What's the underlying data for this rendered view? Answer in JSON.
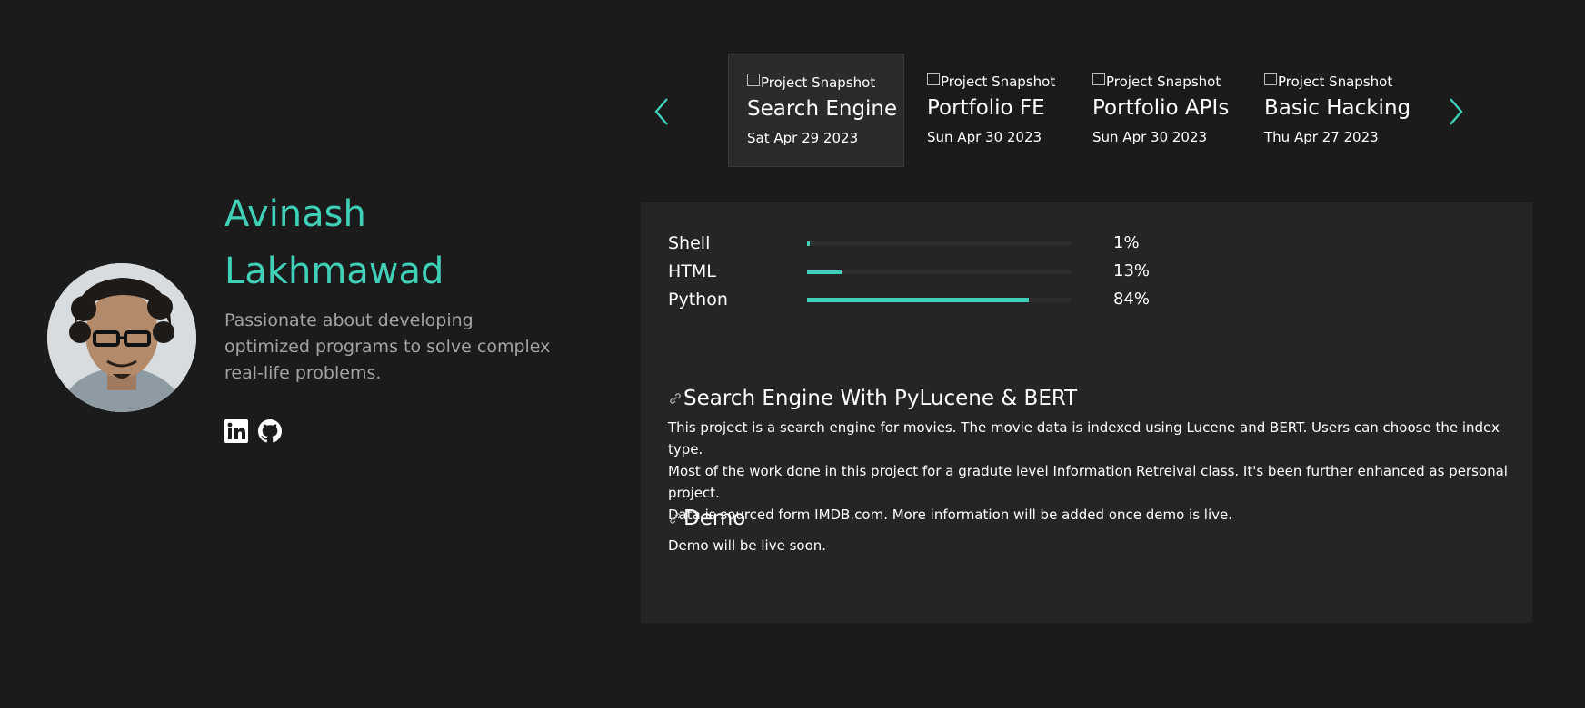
{
  "profile": {
    "first_name": "Avinash",
    "last_name": "Lakhmawad",
    "bio": "Passionate about developing optimized programs to solve complex real-life problems.",
    "socials": [
      "linkedin-icon",
      "github-icon"
    ]
  },
  "carousel": {
    "prev_icon": "chevron-left-icon",
    "next_icon": "chevron-right-icon",
    "cards": [
      {
        "snapshot_alt": "Project Snapshot",
        "title": "Search Engine",
        "date": "Sat Apr 29 2023",
        "active": true
      },
      {
        "snapshot_alt": "Project Snapshot",
        "title": "Portfolio FE",
        "date": "Sun Apr 30 2023",
        "active": false
      },
      {
        "snapshot_alt": "Project Snapshot",
        "title": "Portfolio APIs",
        "date": "Sun Apr 30 2023",
        "active": false
      },
      {
        "snapshot_alt": "Project Snapshot",
        "title": "Basic Hacking",
        "date": "Thu Apr 27 2023",
        "active": false
      }
    ]
  },
  "languages": [
    {
      "name": "Shell",
      "percent_label": "1%",
      "fraction": 0.01
    },
    {
      "name": "HTML",
      "percent_label": "13%",
      "fraction": 0.13
    },
    {
      "name": "Python",
      "percent_label": "84%",
      "fraction": 0.84
    }
  ],
  "detail": {
    "heading": "Search Engine With PyLucene & BERT",
    "para1": "This project is a search engine for movies. The movie data is indexed using Lucene and BERT. Users can choose the index type.",
    "para2": "Most of the work done in this project for a gradute level Information Retreival class. It's been further enhanced as personal project.",
    "para3": "Data is sourced form IMDB.com. More information will be added once demo is live.",
    "demo_heading": "Demo",
    "demo_text": "Demo will be live soon."
  },
  "colors": {
    "accent": "#3fd0b8",
    "background": "#1b1b1b",
    "panel": "#252525",
    "muted_text": "#a3a3a3"
  }
}
